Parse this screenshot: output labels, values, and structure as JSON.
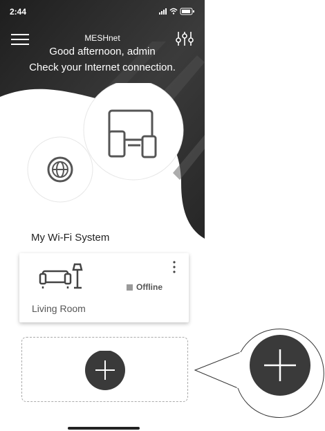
{
  "status_bar": {
    "time": "2:44",
    "icons": "▂▄▆ ᯤ ▭"
  },
  "header": {
    "app_name": "MESHnet",
    "greeting": "Good afternoon, admin",
    "status_message": "Check your Internet connection."
  },
  "diagram": {
    "internet_icon": "globe-icon",
    "devices_icon": "devices-icon"
  },
  "section": {
    "title": "My Wi-Fi System"
  },
  "device_card": {
    "name": "Living Room",
    "status": "Offline",
    "icon": "living-room-icon"
  },
  "add_button": {
    "icon": "plus-icon"
  },
  "colors": {
    "hero_dark": "#2b2b2b",
    "accent_circle": "#3a3a3a",
    "offline": "#9a9a9a"
  }
}
